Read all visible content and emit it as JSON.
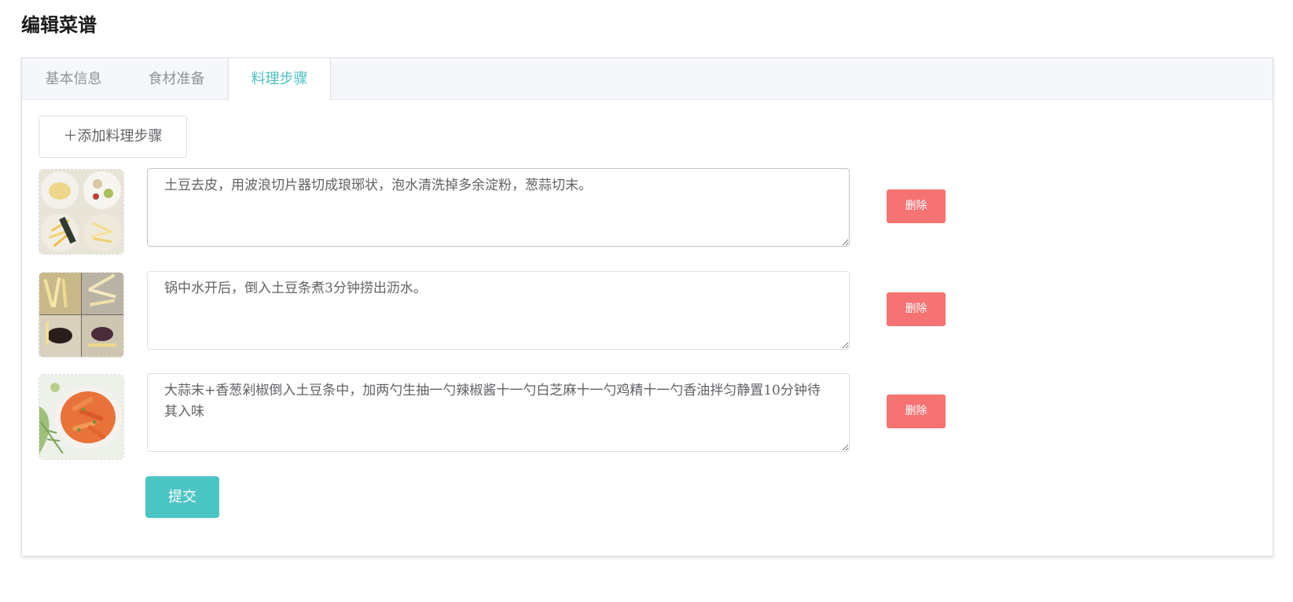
{
  "page": {
    "title": "编辑菜谱"
  },
  "tabs": [
    {
      "label": "基本信息",
      "active": false
    },
    {
      "label": "食材准备",
      "active": false
    },
    {
      "label": "料理步骤",
      "active": true
    }
  ],
  "steps_panel": {
    "add_button_label": "＋添加料理步骤",
    "delete_label": "删除",
    "submit_label": "提交",
    "steps": [
      {
        "text": "土豆去皮，用波浪切片器切成琅琊状，泡水清洗掉多余淀粉，葱蒜切末。",
        "image": "potato-prep-photo"
      },
      {
        "text": "锅中水开后，倒入土豆条煮3分钟捞出沥水。",
        "image": "boiled-potato-photo"
      },
      {
        "text": "大蒜末+香葱剁椒倒入土豆条中，加两勺生抽一勺辣椒酱十一勺白芝麻十一勺鸡精十一勺香油拌匀静置10分钟待其入味",
        "image": "finished-dish-photo"
      }
    ]
  },
  "colors": {
    "accent": "#4bbfbf",
    "danger": "#f56c6c",
    "submit": "#4bc4c4"
  }
}
